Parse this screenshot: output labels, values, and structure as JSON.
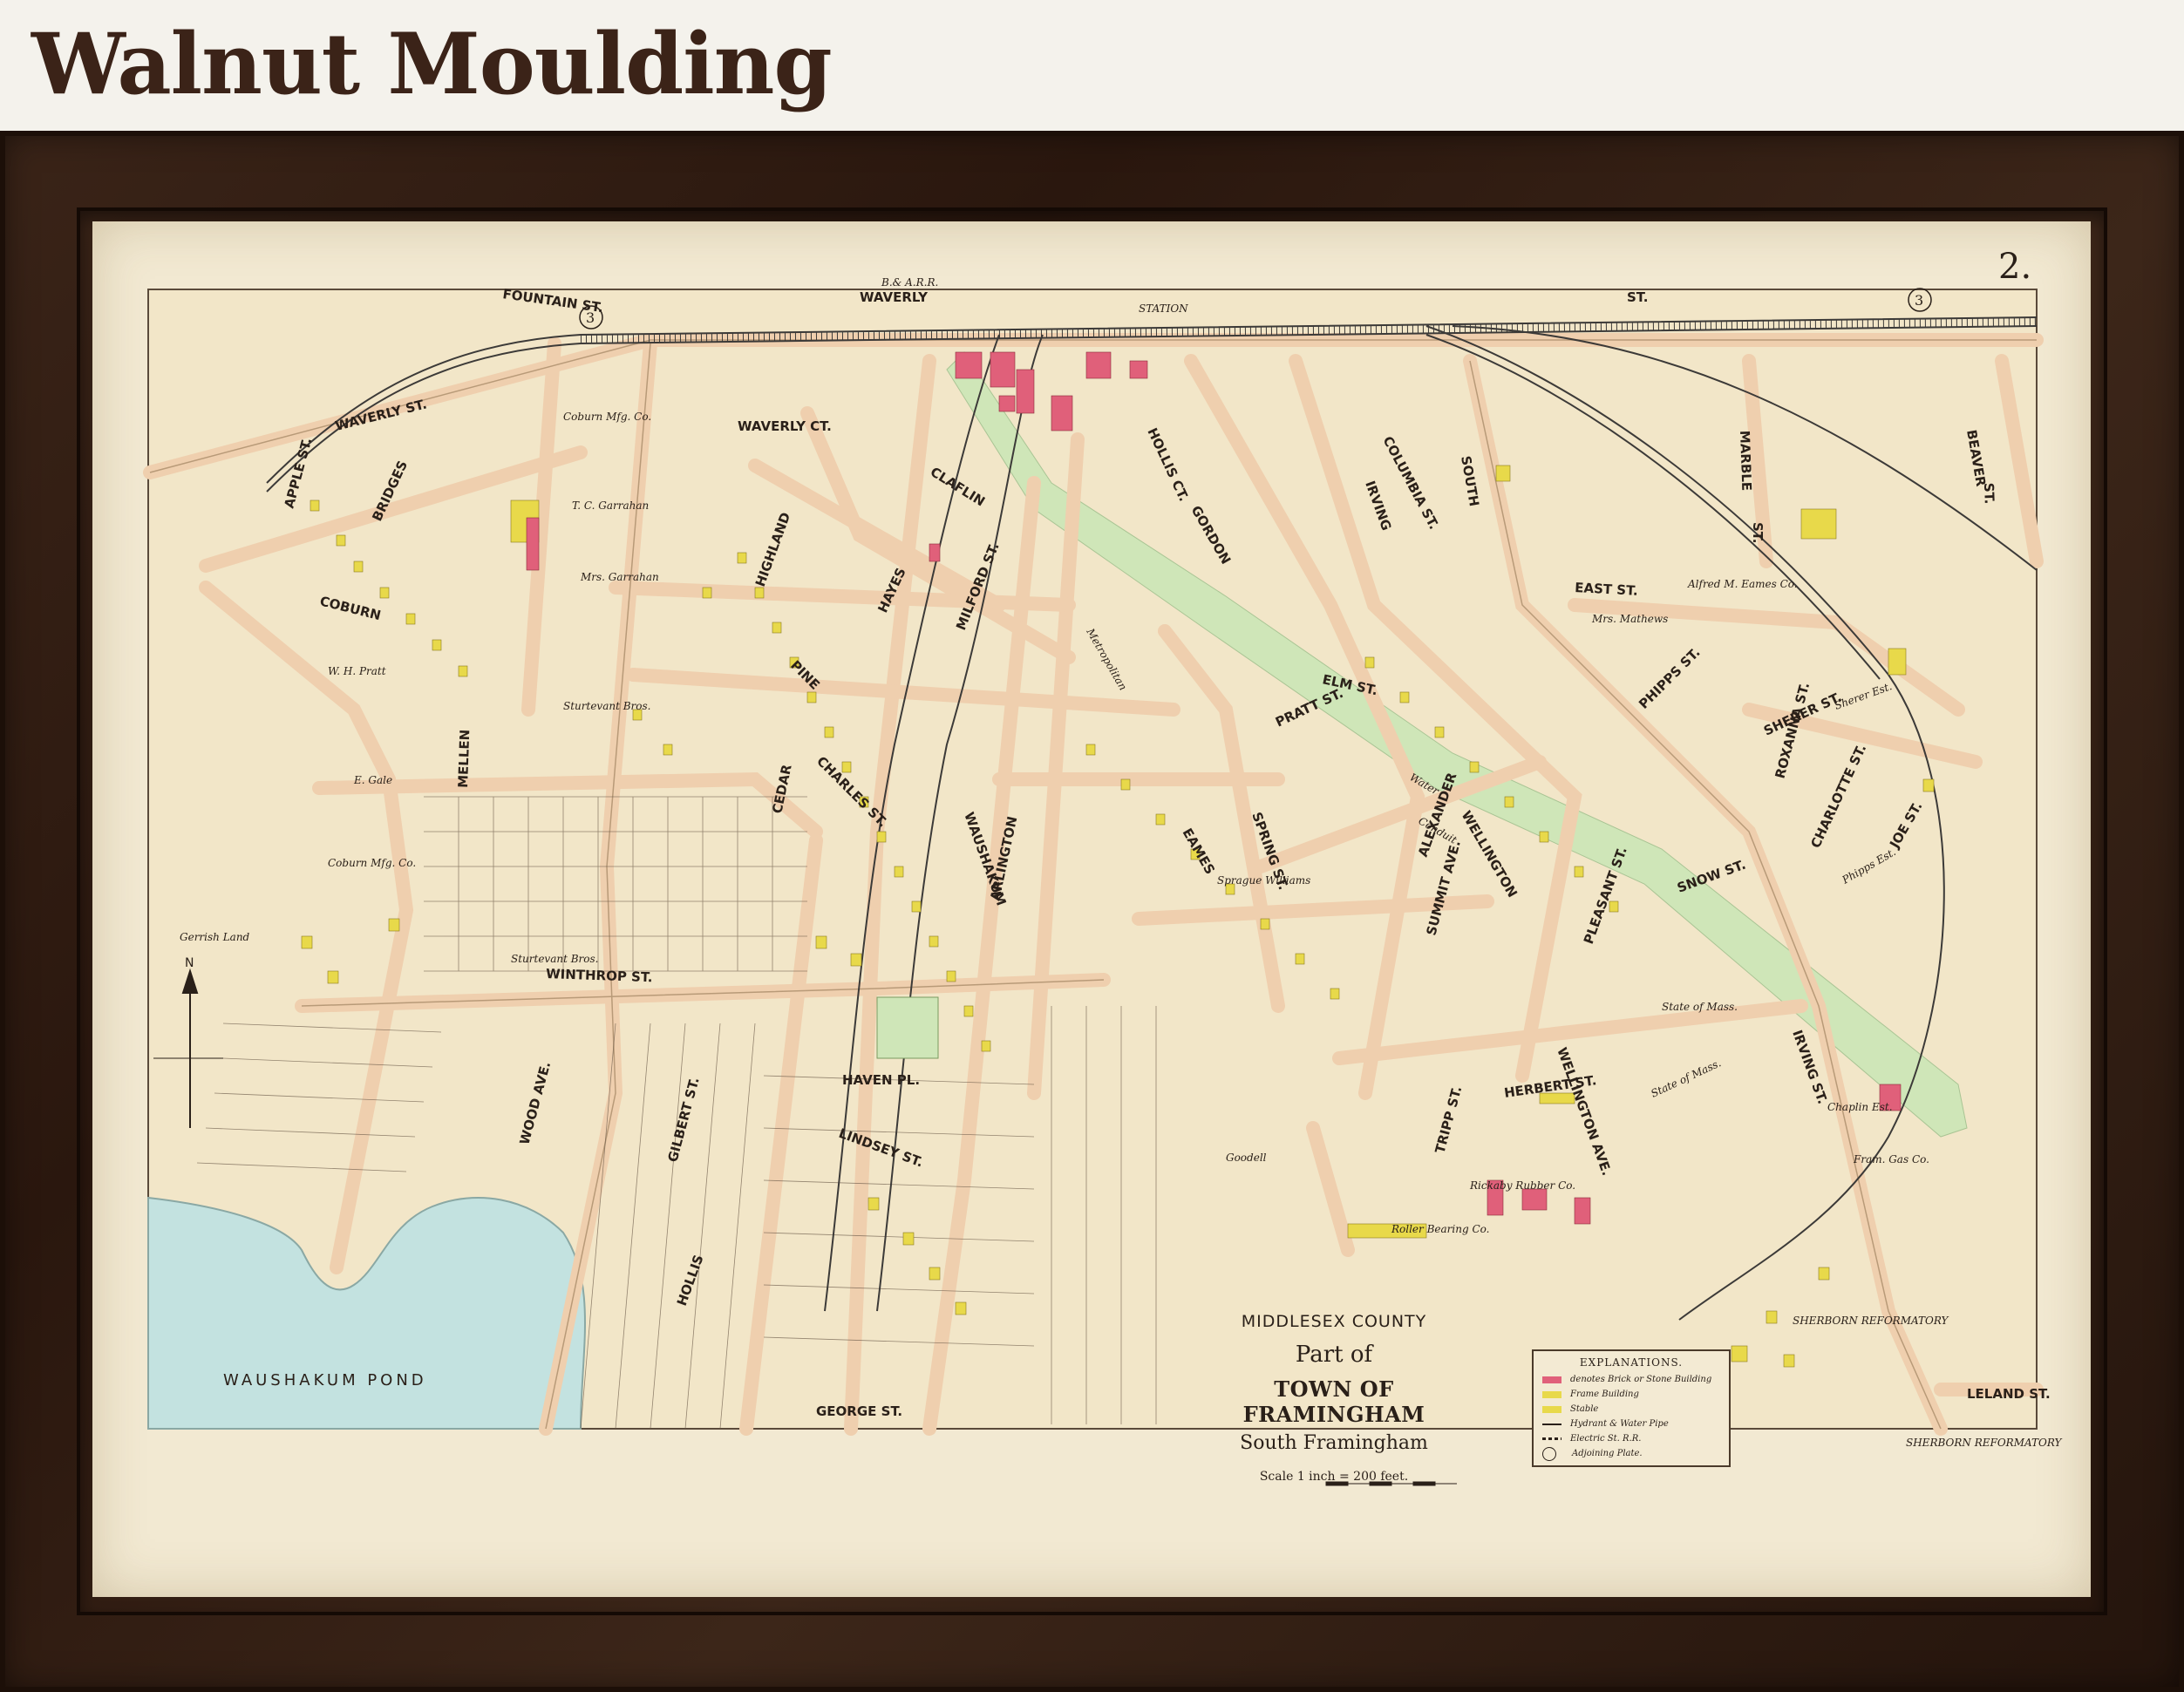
{
  "header": {
    "title": "Walnut Moulding"
  },
  "map": {
    "plate_number": "2.",
    "adjoining_plate": "3",
    "title": {
      "county": "MIDDLESEX COUNTY",
      "part_of": "Part of",
      "town": "TOWN OF FRAMINGHAM",
      "subtitle": "South Framingham",
      "scale": "Scale 1 inch = 200 feet."
    },
    "legend": {
      "title": "EXPLANATIONS.",
      "items": [
        {
          "label": "denotes Brick or Stone Building",
          "color": "#e0607a"
        },
        {
          "label": "Frame Building",
          "color": "#e8d94a"
        },
        {
          "label": "Stable",
          "color": "#e8d94a"
        },
        {
          "label": "Hydrant & Water Pipe",
          "color": "#2a2019"
        },
        {
          "label": "Electric St. R.R.",
          "color": "#2a2019"
        },
        {
          "label": "Adjoining Plate.",
          "color": "#2a2019"
        }
      ]
    },
    "street_labels": [
      "FOUNTAIN ST.",
      "WAVERLY",
      "WAVERLY ST.",
      "ST.",
      "WAVERLY CT.",
      "CLAFLIN",
      "HOLLIS CT.",
      "GORDON",
      "IRVING",
      "COLUMBIA ST.",
      "SOUTH",
      "MARBLE",
      "ST.",
      "BEAVER",
      "ST.",
      "EAST ST.",
      "APPLE ST.",
      "BRIDGES",
      "COBURN",
      "HIGHLAND",
      "HAYES",
      "MILFORD ST.",
      "PINE",
      "CHARLES ST.",
      "CEDAR",
      "MELLEN",
      "WINTHROP ST.",
      "WAUSHAKUM",
      "ARLINGTON",
      "EAMES",
      "PRATT ST.",
      "SPRING ST.",
      "ALEXANDER",
      "WELLINGTON",
      "SUMMIT AVE.",
      "PLEASANT ST.",
      "PHIPPS ST.",
      "SHERER ST.",
      "SNOW ST.",
      "CHARLOTTE ST.",
      "JOE ST.",
      "ROXANNA ST.",
      "IRVING ST.",
      "HERBERT ST.",
      "TRIPP ST.",
      "WELLINGTON AVE.",
      "HAVEN PL.",
      "LINDSEY ST.",
      "GEORGE ST.",
      "GILBERT ST.",
      "WOOD AVE.",
      "HOLLIS",
      "LELAND ST.",
      "ELM ST."
    ],
    "area_labels": [
      "Coburn Mfg. Co.",
      "T. C. Garrahan",
      "Mrs. Garrahan",
      "W. H. Pratt",
      "E. Gale",
      "Coburn Mfg. Co.",
      "Sturtevant Bros.",
      "Sturtevant Bros.",
      "Gerrish Land",
      "Alfred M. Eames Co.",
      "Mrs. Mathews",
      "State of Mass.",
      "State of Mass.",
      "Chaplin Est.",
      "Fram. Gas Co.",
      "Goodell",
      "Rickaby Rubber Co.",
      "Roller Bearing Co.",
      "SHERBORN REFORMATORY",
      "SHERBORN REFORMATORY",
      "Sherer Est.",
      "Phipps Est.",
      "Metropolitan",
      "Water",
      "Conduit",
      "Sprague Williams",
      "STATION",
      "B.& A.R.R."
    ],
    "water_label": "WAUSHAKUM POND",
    "north_label": "N",
    "colors": {
      "paper": "#f2e9d2",
      "road": "#f0d2b4",
      "road_edge": "#a88a6a",
      "frame_building": "#e8d94a",
      "brick_building": "#e0607a",
      "pond": "#bfe0e0",
      "conduit": "#cfe6b8",
      "rail": "#3c3a38"
    }
  }
}
